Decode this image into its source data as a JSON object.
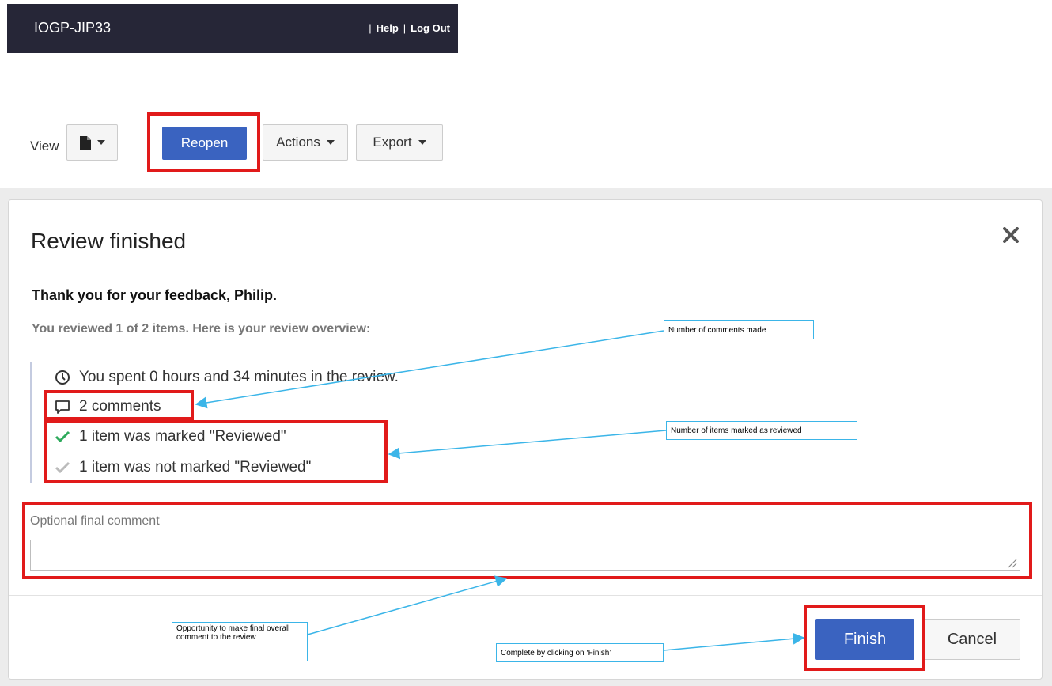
{
  "header": {
    "brand": "IOGP-JIP33",
    "sep1": "|",
    "help": "Help",
    "sep2": "|",
    "logout": "Log Out"
  },
  "toolbar": {
    "view_label": "View",
    "view_icon": "document-icon",
    "reopen_label": "Reopen",
    "actions_label": "Actions",
    "export_label": "Export"
  },
  "dialog": {
    "title": "Review finished",
    "thanks": "Thank you for your feedback, Philip.",
    "summary": "You reviewed 1 of 2 items. Here is your review overview:",
    "stats": {
      "time": "You spent 0 hours and 34 minutes in the review.",
      "comments": "2 comments",
      "reviewed": "1 item was marked \"Reviewed\"",
      "not_reviewed": "1 item was not marked \"Reviewed\""
    },
    "final_comment_label": "Optional final comment",
    "final_comment_value": "",
    "finish_label": "Finish",
    "cancel_label": "Cancel"
  },
  "annotations": {
    "comments": "Number of comments made",
    "reviewed": "Number of items marked as reviewed",
    "final": "Opportunity to make final overall comment to the review",
    "finish": "Complete by clicking on ‘Finish’"
  },
  "colors": {
    "header_bg": "#262637",
    "primary": "#3a63c0",
    "highlight": "#e11a1a",
    "callout_border": "#3bb5e8",
    "check_green": "#2eaa5c",
    "check_grey": "#bbbbbb"
  }
}
